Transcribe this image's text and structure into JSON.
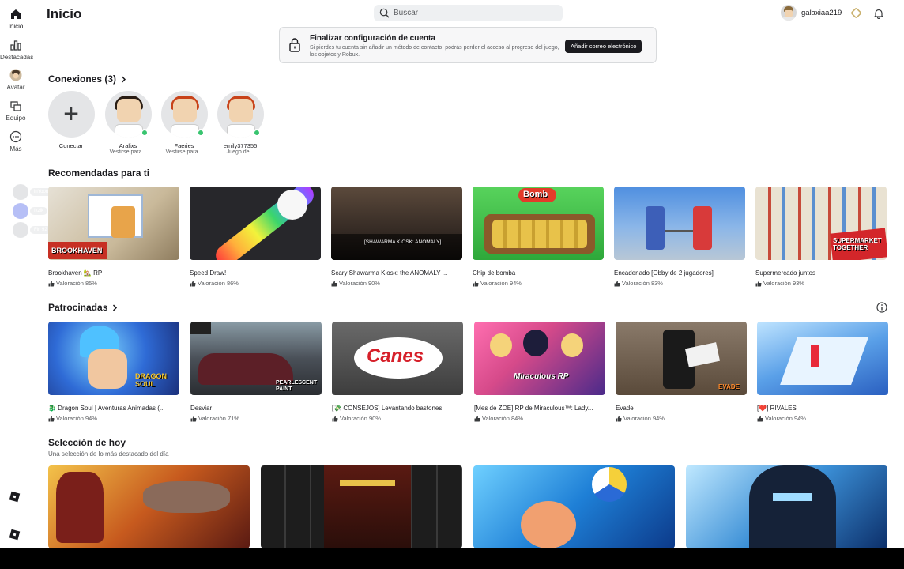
{
  "nav": {
    "items": [
      {
        "label": "Inicio",
        "icon": "home-icon"
      },
      {
        "label": "Destacadas",
        "icon": "chart-icon"
      },
      {
        "label": "Avatar",
        "icon": "avatar-icon"
      },
      {
        "label": "Equipo",
        "icon": "team-icon"
      },
      {
        "label": "Más",
        "icon": "more-icon"
      }
    ]
  },
  "header": {
    "title": "Inicio",
    "search_placeholder": "Buscar",
    "username": "galaxiaa219"
  },
  "banner": {
    "title": "Finalizar configuración de cuenta",
    "text": "Si pierdes tu cuenta sin añadir un método de contacto, podrás perder el acceso al progreso del juego, los objetos y Robux.",
    "button": "Añadir correo electrónico"
  },
  "connections": {
    "title": "Conexiones (3)",
    "items": [
      {
        "name": "Conectar",
        "status": ""
      },
      {
        "name": "Aralixs",
        "status": "Vestirse para..."
      },
      {
        "name": "Faeries",
        "status": "Vestirse para..."
      },
      {
        "name": "emily377355",
        "status": "Juego de..."
      }
    ]
  },
  "side_party": [
    "inYoordirehl",
    "Ikzlk",
    "Fln 92"
  ],
  "recommended": {
    "title": "Recomendadas para ti",
    "games": [
      {
        "title": "Brookhaven 🏡 RP",
        "rating": "Valoración 85%",
        "overlay": "BROOKHAVEN",
        "color": "#d9c7a3"
      },
      {
        "title": "Speed Draw!",
        "rating": "Valoración 86%",
        "overlay": "",
        "color": "#2a2a2e"
      },
      {
        "title": "Scary Shawarma Kiosk: the ANOMALY ...",
        "rating": "Valoración 90%",
        "overlay": "[SHAWARMA KIOSK: ANOMALY]",
        "color": "#3b2e25"
      },
      {
        "title": "Chip de bomba",
        "rating": "Valoración 94%",
        "overlay": "Bomb",
        "color": "#3fb84a"
      },
      {
        "title": "Encadenado [Obby de 2 jugadores]",
        "rating": "Valoración 83%",
        "overlay": "",
        "color": "#7aa3d8"
      },
      {
        "title": "Supermercado juntos",
        "rating": "Valoración 93%",
        "overlay": "SUPERMARKET TOGETHER",
        "color": "#c9b79a"
      }
    ]
  },
  "sponsored": {
    "title": "Patrocinadas",
    "games": [
      {
        "title": "🐉 Dragon Soul | Aventuras Animadas (...",
        "rating": "Valoración 94%",
        "overlay": "DRAGON SOUL",
        "color": "#2f6bd6"
      },
      {
        "title": "Desviar",
        "rating": "Valoración 71%",
        "overlay": "PEARLESCENT PAINT",
        "color": "#4a4f55"
      },
      {
        "title": "[💸 CONSEJOS] Levantando bastones",
        "rating": "Valoración 90%",
        "overlay": "Canes",
        "color": "#4d4d4d"
      },
      {
        "title": "[Mes de ZOE] RP de Miraculous™: Lady...",
        "rating": "Valoración 84%",
        "overlay": "Miraculous RP",
        "color": "#d64a8a"
      },
      {
        "title": "Evade",
        "rating": "Valoración 94%",
        "overlay": "EVADE",
        "color": "#6b5a4a"
      },
      {
        "title": "[❤️] RIVALES",
        "rating": "Valoración 94%",
        "overlay": "",
        "color": "#5aa0e8"
      }
    ]
  },
  "today": {
    "title": "Selección de hoy",
    "subtitle": "Una selección de lo más destacado del día",
    "colors": [
      "#c75a1e",
      "#2b2b2b",
      "#1e7fd6",
      "#3b8fd6"
    ]
  }
}
